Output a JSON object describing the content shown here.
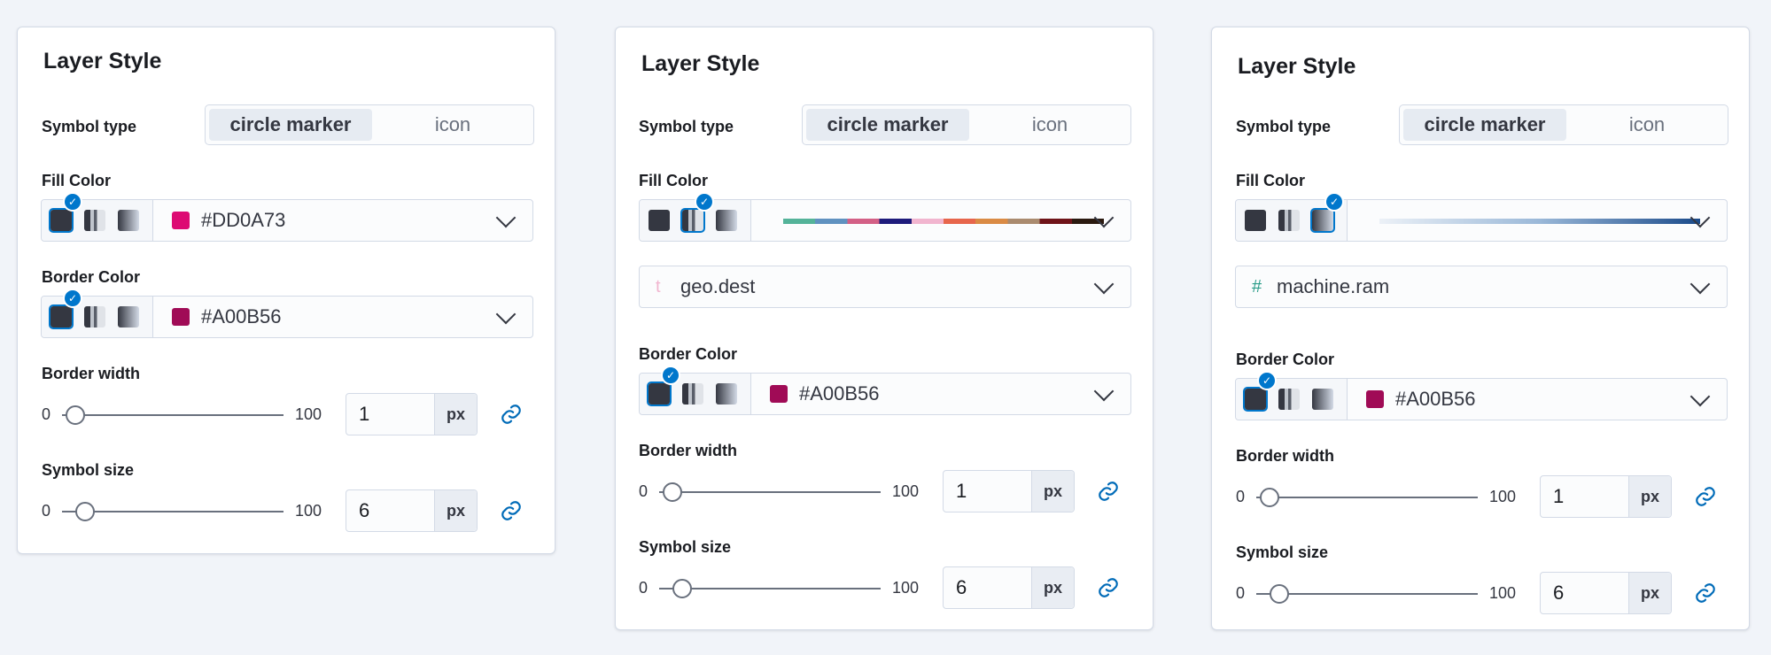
{
  "panels": [
    {
      "title": "Layer Style",
      "symbol_type": {
        "label": "Symbol type",
        "options": [
          "circle marker",
          "icon"
        ],
        "selected": "circle marker"
      },
      "fill_color": {
        "label": "Fill Color",
        "mode": "solid",
        "value": "#DD0A73",
        "swatch": "#DD0A73"
      },
      "border_color": {
        "label": "Border Color",
        "mode": "solid",
        "value": "#A00B56",
        "swatch": "#A00B56"
      },
      "border_width": {
        "label": "Border width",
        "min": "0",
        "max": "100",
        "value": "1",
        "unit": "px"
      },
      "symbol_size": {
        "label": "Symbol size",
        "min": "0",
        "max": "100",
        "value": "6",
        "unit": "px"
      }
    },
    {
      "title": "Layer Style",
      "symbol_type": {
        "label": "Symbol type",
        "options": [
          "circle marker",
          "icon"
        ],
        "selected": "circle marker"
      },
      "fill_color": {
        "label": "Fill Color",
        "mode": "categorical",
        "palette": [
          "#54b399",
          "#6092c0",
          "#d36086",
          "#1e1b7b",
          "#f1b5cf",
          "#e7664c",
          "#da8b45",
          "#aa8b6f",
          "#6f1419",
          "#2b1a10"
        ]
      },
      "field": {
        "icon": "t",
        "name": "geo.dest",
        "icon_color": "#f1b5cf"
      },
      "border_color": {
        "label": "Border Color",
        "mode": "solid",
        "value": "#A00B56",
        "swatch": "#A00B56"
      },
      "border_width": {
        "label": "Border width",
        "min": "0",
        "max": "100",
        "value": "1",
        "unit": "px"
      },
      "symbol_size": {
        "label": "Symbol size",
        "min": "0",
        "max": "100",
        "value": "6",
        "unit": "px"
      }
    },
    {
      "title": "Layer Style",
      "symbol_type": {
        "label": "Symbol type",
        "options": [
          "circle marker",
          "icon"
        ],
        "selected": "circle marker"
      },
      "fill_color": {
        "label": "Fill Color",
        "mode": "gradient",
        "gradient": [
          "#ecf1f7",
          "#9ab8d8",
          "#1a4a8a"
        ]
      },
      "field": {
        "icon": "#",
        "name": "machine.ram",
        "icon_color": "#2b9c89"
      },
      "border_color": {
        "label": "Border Color",
        "mode": "solid",
        "value": "#A00B56",
        "swatch": "#A00B56"
      },
      "border_width": {
        "label": "Border width",
        "min": "0",
        "max": "100",
        "value": "1",
        "unit": "px"
      },
      "symbol_size": {
        "label": "Symbol size",
        "min": "0",
        "max": "100",
        "value": "6",
        "unit": "px"
      }
    }
  ],
  "colors": {
    "accent": "#0077cc",
    "link": "#006bb8"
  }
}
